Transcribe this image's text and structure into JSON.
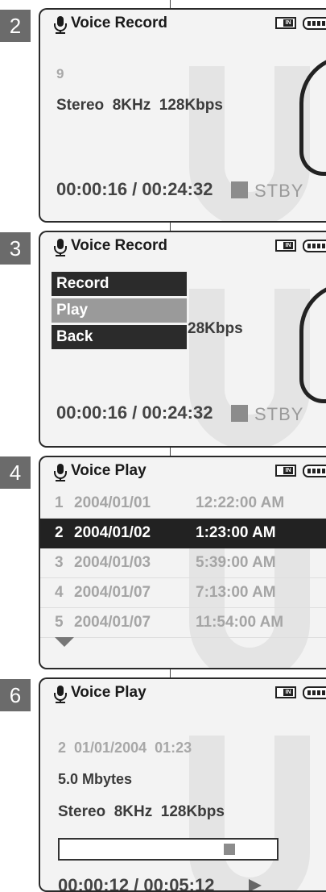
{
  "step2": {
    "step_number": "2",
    "title": "Voice Record",
    "in_label": "IN",
    "file_number": "9",
    "audio_info": "Stereo  8KHz  128Kbps",
    "time": "00:00:16 / 00:24:32",
    "status": "STBY"
  },
  "step3": {
    "step_number": "3",
    "title": "Voice Record",
    "in_label": "IN",
    "menu": [
      {
        "label": "Record",
        "selected": false
      },
      {
        "label": "Play",
        "selected": true
      },
      {
        "label": "Back",
        "selected": false
      }
    ],
    "partial_info": "28Kbps",
    "time": "00:00:16 / 00:24:32",
    "status": "STBY"
  },
  "step4": {
    "step_number": "4",
    "title": "Voice Play",
    "in_label": "IN",
    "files": [
      {
        "index": "1",
        "date": "2004/01/01",
        "time": "12:22:00 AM",
        "selected": false
      },
      {
        "index": "2",
        "date": "2004/01/02",
        "time": "1:23:00 AM",
        "selected": true
      },
      {
        "index": "3",
        "date": "2004/01/03",
        "time": "5:39:00 AM",
        "selected": false
      },
      {
        "index": "4",
        "date": "2004/01/07",
        "time": "7:13:00 AM",
        "selected": false
      },
      {
        "index": "5",
        "date": "2004/01/07",
        "time": "11:54:00 AM",
        "selected": false
      }
    ]
  },
  "step6": {
    "step_number": "6",
    "title": "Voice Play",
    "in_label": "IN",
    "file_info": "2  01/01/2004  01:23",
    "size": "5.0 Mbytes",
    "audio_info": "Stereo  8KHz  128Kbps",
    "progress_fraction": 0.78,
    "time": "00:00:12 / 00:05:12"
  },
  "colors": {
    "screen_bg": "#f3f3f3",
    "badge_bg": "#6b6b6b",
    "highlight_dark": "#222222",
    "highlight_grey": "#9a9a9a"
  }
}
